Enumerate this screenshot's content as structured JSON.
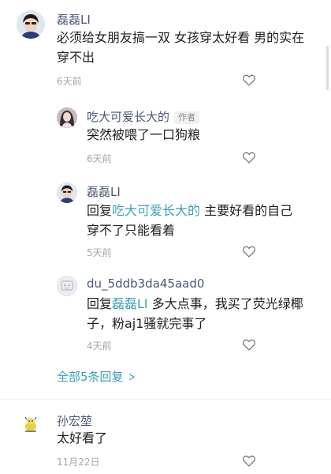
{
  "comments": [
    {
      "user": "磊磊LI",
      "text": "必须给女朋友搞一双 女孩穿太好看 男的实在穿不出",
      "time": "6天前",
      "icon": "heart-outline-icon"
    }
  ],
  "replies": [
    {
      "user": "吃大可爱长大的",
      "tag": "作者",
      "text": "突然被喂了一口狗粮",
      "time": "6天前"
    },
    {
      "user": "磊磊LI",
      "prefix": "回复",
      "mention": "吃大可爱长大的",
      "text": " 主要好看的自己穿不了只能看着",
      "time": "5天前"
    },
    {
      "user": "du_5ddb3da45aad0",
      "prefix": "回复",
      "mention": "磊磊LI",
      "text": " 多大点事，我买了荧光绿椰子，粉aj1骚就完事了",
      "time": "4天前"
    }
  ],
  "expand_label": "全部5条回复",
  "second_comment": {
    "user": "孙宏堃",
    "text": "太好看了",
    "time": "11月22日"
  },
  "colors": {
    "username": "#4a5775",
    "mention": "#3a9fb3",
    "timestamp": "#a6a6a6"
  }
}
